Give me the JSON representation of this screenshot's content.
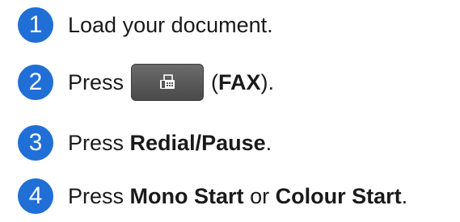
{
  "steps": [
    {
      "number": "1",
      "text": "Load your document."
    },
    {
      "number": "2",
      "prefix": "Press",
      "button_icon": "fax-icon",
      "open": "(",
      "bold": "FAX",
      "close": ")."
    },
    {
      "number": "3",
      "prefix": "Press",
      "bold": "Redial/Pause",
      "suffix": "."
    },
    {
      "number": "4",
      "prefix": "Press",
      "bold1": "Mono Start",
      "middle": "or",
      "bold2": "Colour Start",
      "suffix": "."
    }
  ],
  "colors": {
    "step_circle": "#1f6fd6",
    "button": "#555555"
  }
}
